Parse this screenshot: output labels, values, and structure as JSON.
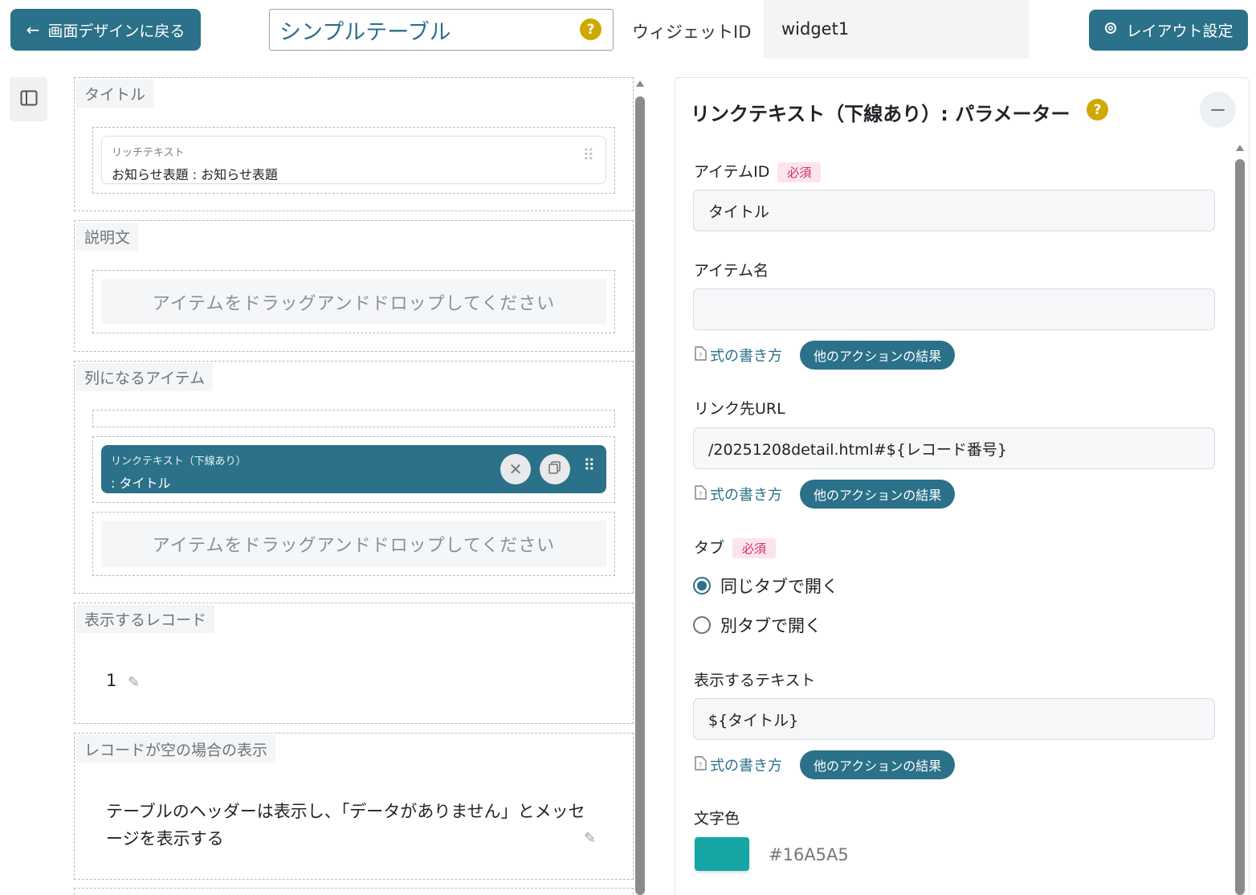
{
  "header": {
    "back_label": "画面デザインに戻る",
    "widget_title": "シンプルテーブル",
    "help_glyph": "?",
    "widget_id_label": "ウィジェットID",
    "widget_id_value": "widget1",
    "layout_label": "レイアウト設定"
  },
  "colors": {
    "accent": "#2a7189",
    "help": "#cfa800",
    "required": "#d32f5d",
    "text_color_value": "#16A5A5"
  },
  "left": {
    "sections": {
      "title": {
        "label": "タイトル",
        "card_type": "リッチテキスト",
        "card_value": "お知らせ表題 : お知らせ表題"
      },
      "description": {
        "label": "説明文",
        "drop_hint": "アイテムをドラッグアンドドロップしてください"
      },
      "column_items": {
        "label": "列になるアイテム",
        "card_type": "リンクテキスト（下線あり）",
        "card_value": ": タイトル",
        "drop_hint": "アイテムをドラッグアンドドロップしてください"
      },
      "records": {
        "label": "表示するレコード",
        "value": "1"
      },
      "empty": {
        "label": "レコードが空の場合の表示",
        "value": "テーブルのヘッダーは表示し、「データがありません」とメッセージを表示する"
      }
    }
  },
  "right": {
    "title": "リンクテキスト（下線あり）: パラメーター",
    "required_badge": "必須",
    "formula_link": "式の書き方",
    "other_action_results": "他のアクションの結果",
    "fields": {
      "item_id": {
        "label": "アイテムID",
        "value": "タイトル"
      },
      "item_name": {
        "label": "アイテム名",
        "value": ""
      },
      "link_url": {
        "label": "リンク先URL",
        "value": "/20251208detail.html#${レコード番号}"
      },
      "tab": {
        "label": "タブ",
        "options": [
          "同じタブで開く",
          "別タブで開く"
        ],
        "selected": "同じタブで開く"
      },
      "display_text": {
        "label": "表示するテキスト",
        "value": "${タイトル}"
      },
      "text_color": {
        "label": "文字色",
        "value": "#16A5A5"
      }
    }
  },
  "icons": [
    "arrow-left-icon",
    "gear-icon",
    "sidebar-panel-icon",
    "drag-handle-icon",
    "close-icon",
    "copy-icon",
    "pencil-icon",
    "formula-doc-icon",
    "minus-icon"
  ]
}
